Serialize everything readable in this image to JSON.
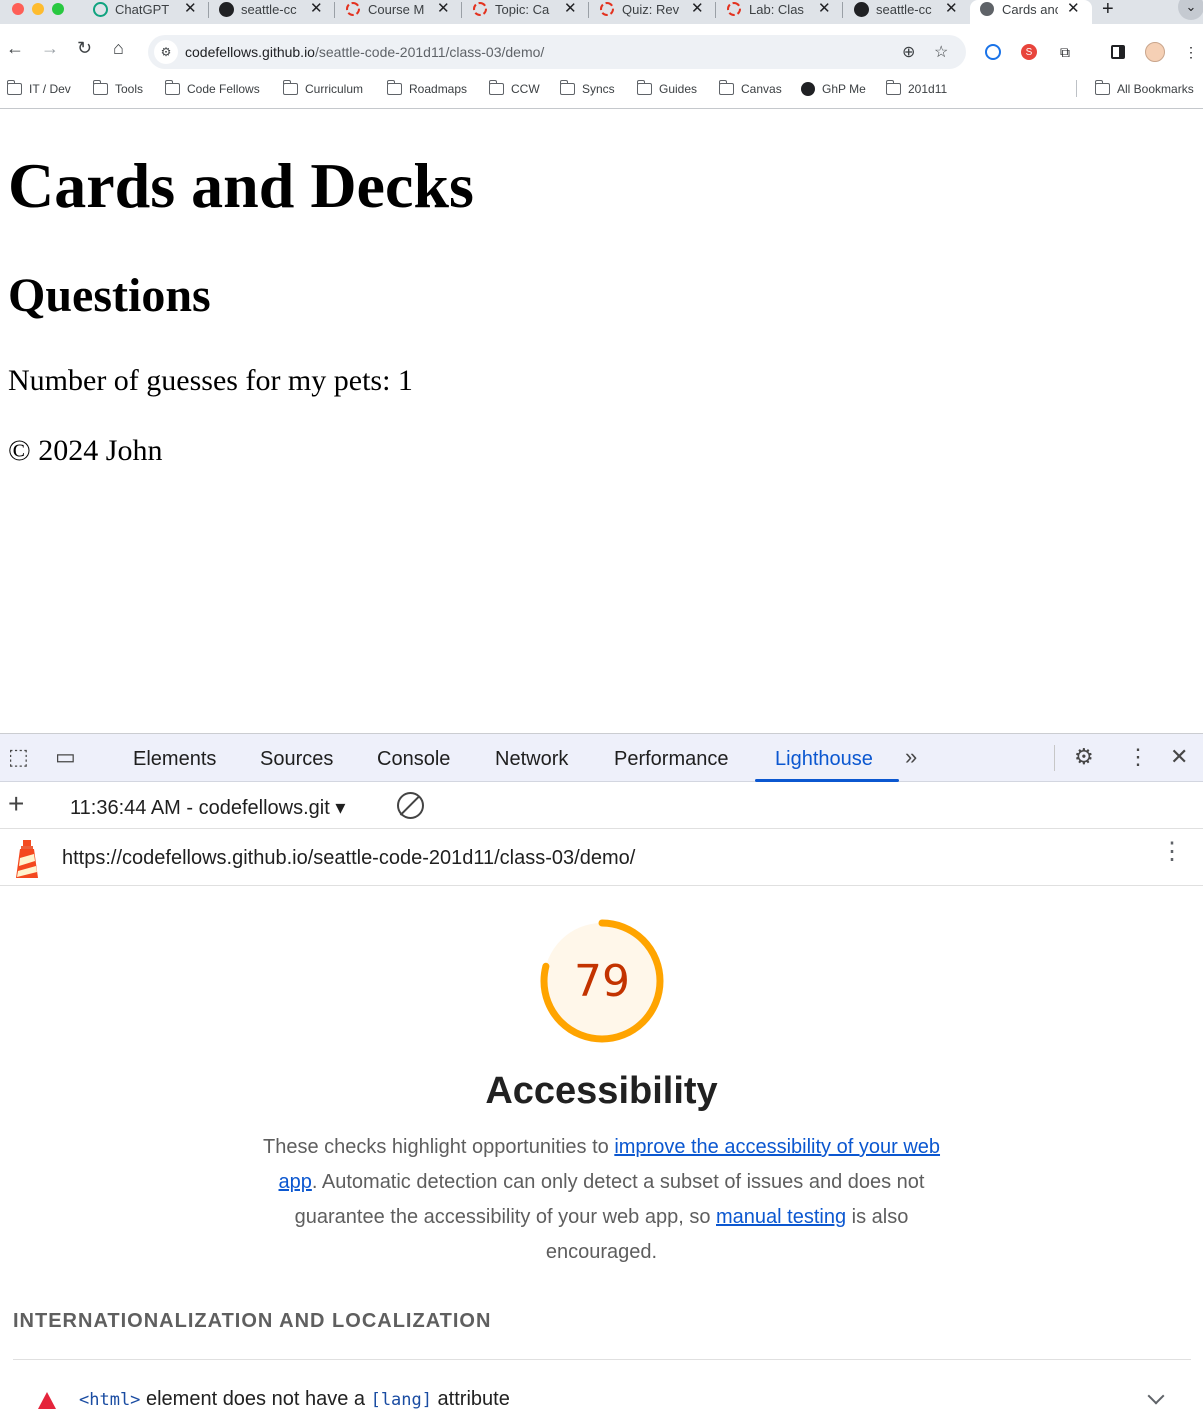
{
  "browser": {
    "tabs": [
      {
        "title": "ChatGPT",
        "icon": "chatgpt-icon"
      },
      {
        "title": "seattle-cc",
        "icon": "github-icon"
      },
      {
        "title": "Course M",
        "icon": "canvas-icon"
      },
      {
        "title": "Topic: Ca",
        "icon": "canvas-icon"
      },
      {
        "title": "Quiz: Rev",
        "icon": "canvas-icon"
      },
      {
        "title": "Lab: Clas",
        "icon": "canvas-icon"
      },
      {
        "title": "seattle-cc",
        "icon": "github-icon"
      },
      {
        "title": "Cards anc",
        "icon": "globe-icon"
      }
    ],
    "url_host": "codefellows.github.io",
    "url_path": "/seattle-code-201d11/class-03/demo/",
    "bookmarks": [
      {
        "label": "IT / Dev"
      },
      {
        "label": "Tools"
      },
      {
        "label": "Code Fellows"
      },
      {
        "label": "Curriculum"
      },
      {
        "label": "Roadmaps"
      },
      {
        "label": "CCW"
      },
      {
        "label": "Syncs"
      },
      {
        "label": "Guides"
      },
      {
        "label": "Canvas"
      },
      {
        "label": "GhP Me"
      },
      {
        "label": "201d11"
      }
    ],
    "all_bookmarks": "All Bookmarks"
  },
  "page": {
    "h1": "Cards and Decks",
    "h2": "Questions",
    "paragraph": "Number of guesses for my pets: 1",
    "footer": "© 2024 John"
  },
  "devtools": {
    "tabs": [
      "Elements",
      "Sources",
      "Console",
      "Network",
      "Performance",
      "Lighthouse"
    ],
    "active_tab": "Lighthouse",
    "report_label": "11:36:44 AM - codefellows.git",
    "report_url": "https://codefellows.github.io/seattle-code-201d11/class-03/demo/",
    "score": 79,
    "score_text": "79",
    "score_color": "#c33300",
    "gauge_color": "#ffa400",
    "category_title": "Accessibility",
    "description": {
      "part1": "These checks highlight opportunities to ",
      "link1": "improve the accessibility of your web app",
      "part2": ". Automatic detection can only detect a subset of issues and does not guarantee the accessibility of your web app, so ",
      "link2": "manual testing",
      "part3": " is also encouraged."
    },
    "group_title": "INTERNATIONALIZATION AND LOCALIZATION",
    "audit": {
      "code1": "<html>",
      "text1": " element does not have a ",
      "code2": "[lang]",
      "text2": " attribute",
      "status_color": "#e5243b"
    }
  }
}
